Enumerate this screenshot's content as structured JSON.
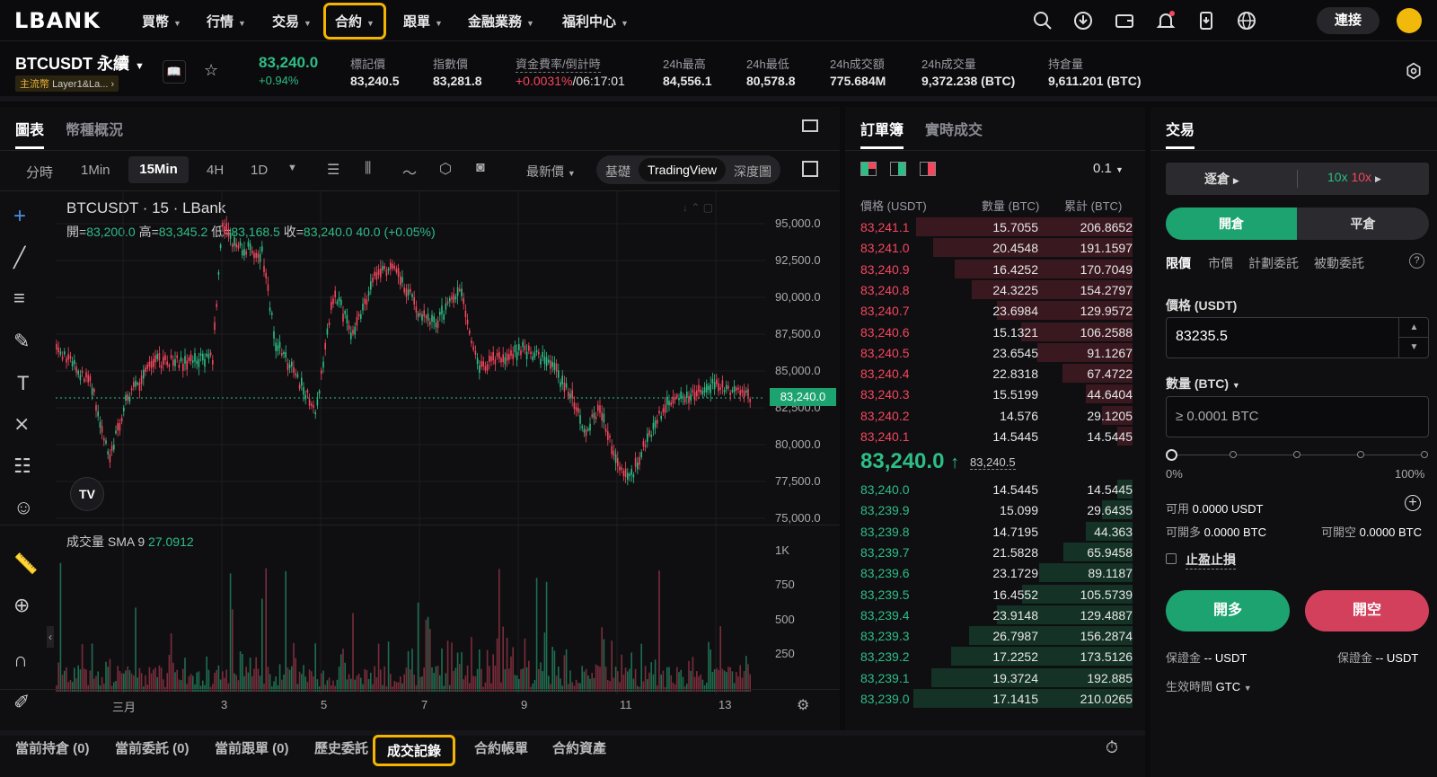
{
  "nav": {
    "logo": "LBANK",
    "items": [
      {
        "label": "買幣"
      },
      {
        "label": "行情"
      },
      {
        "label": "交易"
      },
      {
        "label": "合約"
      },
      {
        "label": "跟單"
      },
      {
        "label": "金融業務"
      },
      {
        "label": "福利中心"
      }
    ],
    "connect": "連接"
  },
  "ticker": {
    "symbol": "BTCUSDT 永續",
    "tag1": "主流幣",
    "tag2": "Layer1&La...",
    "price": "83,240.0",
    "change": "+0.94%",
    "stats": [
      {
        "label": "標記價",
        "value": "83,240.5"
      },
      {
        "label": "指數價",
        "value": "83,281.8"
      },
      {
        "label": "資金費率/倒計時",
        "value": "+0.0031%",
        "value2": "/06:17:01"
      },
      {
        "label": "24h最高",
        "value": "84,556.1"
      },
      {
        "label": "24h最低",
        "value": "80,578.8"
      },
      {
        "label": "24h成交額",
        "value": "775.684M"
      },
      {
        "label": "24h成交量",
        "value": "9,372.238 (BTC)"
      },
      {
        "label": "持倉量",
        "value": "9,611.201 (BTC)"
      }
    ]
  },
  "chart": {
    "tabs": [
      "圖表",
      "幣種概況"
    ],
    "intervals": [
      "分時",
      "1Min",
      "15Min",
      "4H",
      "1D"
    ],
    "price_type": "最新價",
    "views": [
      "基礎",
      "TradingView",
      "深度圖"
    ],
    "title": "BTCUSDT · 15 · LBank",
    "ohlc": {
      "o_lbl": "開=",
      "o": "83,200.0",
      "h_lbl": "高=",
      "h": "83,345.2",
      "l_lbl": "低=",
      "l": "83,168.5",
      "c_lbl": "收=",
      "c": "83,240.0",
      "chg": "40.0 (+0.05%)"
    },
    "price_tag": "83,240.0",
    "y_ticks": [
      "95,000.0",
      "92,500.0",
      "90,000.0",
      "87,500.0",
      "85,000.0",
      "82,500.0",
      "80,000.0",
      "77,500.0",
      "75,000.0"
    ],
    "vol_label": "成交量 SMA 9",
    "vol_value": "27.0912",
    "vol_ticks": [
      "1K",
      "750",
      "500",
      "250"
    ],
    "x_ticks": [
      "三月",
      "3",
      "5",
      "7",
      "9",
      "11",
      "13"
    ]
  },
  "orderbook": {
    "tabs": [
      "訂單簿",
      "實時成交"
    ],
    "precision": "0.1",
    "headers": [
      "價格 (USDT)",
      "數量 (BTC)",
      "累計 (BTC)"
    ],
    "asks": [
      [
        "83,241.1",
        "15.7055",
        "206.8652"
      ],
      [
        "83,241.0",
        "20.4548",
        "191.1597"
      ],
      [
        "83,240.9",
        "16.4252",
        "170.7049"
      ],
      [
        "83,240.8",
        "24.3225",
        "154.2797"
      ],
      [
        "83,240.7",
        "23.6984",
        "129.9572"
      ],
      [
        "83,240.6",
        "15.1321",
        "106.2588"
      ],
      [
        "83,240.5",
        "23.6545",
        "91.1267"
      ],
      [
        "83,240.4",
        "22.8318",
        "67.4722"
      ],
      [
        "83,240.3",
        "15.5199",
        "44.6404"
      ],
      [
        "83,240.2",
        "14.576",
        "29.1205"
      ],
      [
        "83,240.1",
        "14.5445",
        "14.5445"
      ]
    ],
    "last_price": "83,240.0",
    "arrow": "↑",
    "mark": "83,240.5",
    "bids": [
      [
        "83,240.0",
        "14.5445",
        "14.5445"
      ],
      [
        "83,239.9",
        "15.099",
        "29.6435"
      ],
      [
        "83,239.8",
        "14.7195",
        "44.363"
      ],
      [
        "83,239.7",
        "21.5828",
        "65.9458"
      ],
      [
        "83,239.6",
        "23.1729",
        "89.1187"
      ],
      [
        "83,239.5",
        "16.4552",
        "105.5739"
      ],
      [
        "83,239.4",
        "23.9148",
        "129.4887"
      ],
      [
        "83,239.3",
        "26.7987",
        "156.2874"
      ],
      [
        "83,239.2",
        "17.2252",
        "173.5126"
      ],
      [
        "83,239.1",
        "19.3724",
        "192.885"
      ],
      [
        "83,239.0",
        "17.1415",
        "210.0265"
      ]
    ]
  },
  "trade": {
    "title": "交易",
    "margin_mode": "逐倉",
    "lev1": "10x",
    "lev2": "10x",
    "open": "開倉",
    "close": "平倉",
    "order_types": [
      "限價",
      "市價",
      "計劃委託",
      "被動委託"
    ],
    "price_label": "價格 (USDT)",
    "price_value": "83235.5",
    "qty_label": "數量 (BTC)",
    "qty_placeholder": "≥ 0.0001 BTC",
    "pct_min": "0%",
    "pct_max": "100%",
    "avail_lbl": "可用",
    "avail": "0.0000 USDT",
    "long_lbl": "可開多",
    "long": "0.0000 BTC",
    "short_lbl": "可開空",
    "short": "0.0000 BTC",
    "tpsl": "止盈止損",
    "buy": "開多",
    "sell": "開空",
    "margin_lbl": "保證金",
    "margin_long": "-- USDT",
    "margin_short": "-- USDT",
    "tif_lbl": "生效時間",
    "tif": "GTC"
  },
  "bottom": {
    "tabs": [
      "當前持倉 (0)",
      "當前委託 (0)",
      "當前跟單 (0)",
      "歷史委託",
      "成交記錄",
      "合約帳單",
      "合約資產"
    ]
  }
}
